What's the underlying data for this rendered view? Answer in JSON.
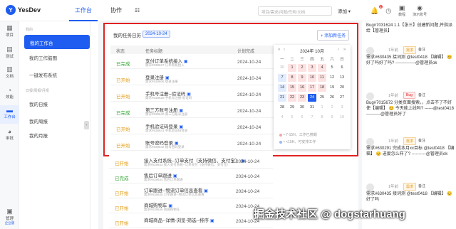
{
  "app": {
    "logo_text": "YesDev"
  },
  "topnav": {
    "workbench": "工作台",
    "collab": "协作"
  },
  "search": {
    "placeholder": "项目/需求/问题/任务/文档"
  },
  "top_actions": {
    "add": "添加 ▾",
    "tutorial": "教程",
    "ext": "演示账号",
    "badge_count": "1"
  },
  "rail": [
    {
      "icon": "project-icon",
      "label": "项目"
    },
    {
      "icon": "test-icon",
      "label": "测试"
    },
    {
      "icon": "doc-icon",
      "label": "文档"
    },
    {
      "icon": "dashboard-icon",
      "label": "效能"
    },
    {
      "icon": "workbench-icon",
      "label": "工作台"
    },
    {
      "icon": "team-icon",
      "label": "审批"
    },
    {
      "icon": "admin-icon",
      "label": "管理",
      "sub": "企业版"
    }
  ],
  "side": {
    "group1": "我的",
    "items1": [
      "我的工作台",
      "我的工作脑图",
      "一键发布系统"
    ],
    "group2": "日报/周报/月报",
    "items2": [
      "我的日报",
      "我的周报",
      "我的月报"
    ]
  },
  "card": {
    "title": "我的任务日历",
    "date_tag": "2024-10-24",
    "add_task": "+ 添加新任务"
  },
  "table": {
    "headers": [
      "状态",
      "任务标题",
      "计划完成"
    ],
    "rows": [
      {
        "status": "已完成",
        "state": "done",
        "title": "支付订单系统接入",
        "sub": "需求#638627 订单系统接入",
        "date": "2024-10-24"
      },
      {
        "status": "已开始",
        "state": "todo",
        "title": "登录注册",
        "sub": "需求#638806 登录注册",
        "date": "2024-10-24"
      },
      {
        "status": "已开始",
        "state": "todo",
        "title": "手机号注册--验证码",
        "sub": "需求#638628 手机号注册-验证码",
        "date": "2024-10-24"
      },
      {
        "status": "已完成",
        "state": "done",
        "title": "第三方账号注册",
        "sub": "需求#638640 第三方账号注册",
        "date": "2024-10-24"
      },
      {
        "status": "已开始",
        "state": "todo",
        "title": "手机验证码登录",
        "sub": "需求#638641 手机验证码登录",
        "date": "2024-10-24"
      },
      {
        "status": "已开始",
        "state": "todo",
        "title": "账号密码登录",
        "sub": "需求#638642 账号密码登录",
        "date": "2024-10-24"
      }
    ],
    "rows_below": [
      {
        "status": "已开始",
        "state": "todo",
        "title": "接入支付系统--订单支付（支持微信、支付宝）",
        "sub": "需求#638643 接入支付系统--订单支付（支持微信、支付宝）",
        "date": "2024-10-24"
      },
      {
        "status": "已完成",
        "state": "done",
        "title": "售后订单跟进",
        "sub": "需求#638644 售后订单跟进",
        "date": "2024-10-24"
      },
      {
        "status": "已开始",
        "state": "todo",
        "title": "订单跟进--物流订单信息查看",
        "sub": "需求#638645 订单跟进--物流订单信息查看",
        "date": "2024-10-24"
      },
      {
        "status": "已开始",
        "state": "todo",
        "title": "商城购物车",
        "sub": "需求#638646 商城购物车",
        "date": "2024-10-24"
      },
      {
        "status": "已开始",
        "state": "todo",
        "title": "商城商品--详情-浏览-筛选--排序",
        "sub": "",
        "date": "2024-10-24"
      }
    ]
  },
  "calendar": {
    "month_label": "2024年 10月",
    "weekdays": [
      "一",
      "二",
      "三",
      "四",
      "五",
      "六",
      "日"
    ],
    "days": [
      "30",
      "1",
      "2",
      "3",
      "4",
      "5",
      "6",
      "7",
      "8",
      "9",
      "10",
      "11",
      "12",
      "13",
      "14",
      "15",
      "16",
      "17",
      "18",
      "19",
      "20",
      "21",
      "22",
      "23",
      "24",
      "25",
      "26",
      "27",
      "28",
      "29",
      "30",
      "31",
      "1",
      "2",
      "3",
      "4",
      "5",
      "6",
      "7",
      "8",
      "9",
      "10"
    ],
    "selected": "24",
    "legend1": "• 7-15H、工作已排期",
    "legend2": "• <15H、可安排工作",
    "colors": {
      "selected": "#1f5df0",
      "busy": "#fde2e2",
      "free": "#e2ecff"
    }
  },
  "feed": {
    "top_text": "Bug#7031624 1.1【张三】创建新问题,并指派给【管理员】",
    "items": [
      {
        "ago": "1年前",
        "tag": "需求",
        "tag_type": "req",
        "note": "备注",
        "text": "需求#630435 接词测 @test0418 【编辑】 😊 好了吗好了吗? --------------@管理员ok"
      },
      {
        "ago": "1年前",
        "tag": "Bug",
        "tag_type": "bug",
        "note": "备注",
        "text": "Bug#7015672 分类页面搜索。，点击不了不好使【编辑】 😊 今天能上线吗? ------@test0418 ----------@管理员好了"
      },
      {
        "ago": "1年前",
        "tag": "需求",
        "tag_type": "req",
        "note": "备注",
        "text": "需求#630291 完成本月xx目标 @test0418 【编辑】 😊 进度怎么样了? ----------@管理员ok"
      },
      {
        "ago": "1年前",
        "tag": "需求",
        "tag_type": "req",
        "note": "备注",
        "text": "需求#630435 接词测 @test0418 【编辑】 😊 好了吗"
      }
    ]
  },
  "watermark": "掘金技术社区 @ dogstarhuang"
}
